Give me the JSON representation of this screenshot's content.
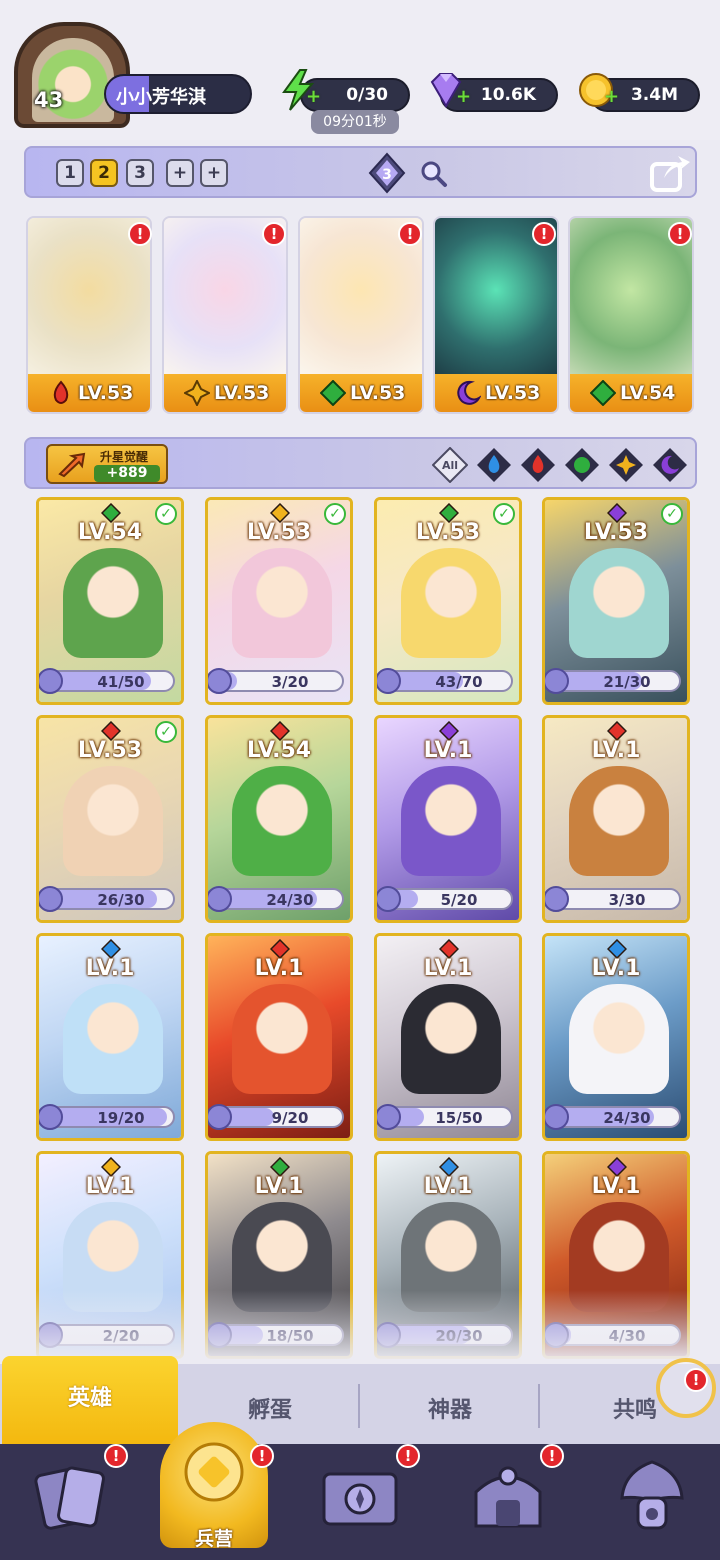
{
  "player": {
    "level": "43",
    "name": "小小芳华淇"
  },
  "resources": {
    "energy": "0/30",
    "energy_timer": "09分01秒",
    "gems": "10.6K",
    "coins": "3.4M",
    "plus": "+"
  },
  "team_tabs": [
    "1",
    "2",
    "3",
    "+",
    "+"
  ],
  "team_active_index": 1,
  "crystal_count": "3",
  "lineup": [
    {
      "level": "LV.53",
      "element": "fire",
      "alert": "!"
    },
    {
      "level": "LV.53",
      "element": "light",
      "alert": "!"
    },
    {
      "level": "LV.53",
      "element": "nature",
      "alert": "!"
    },
    {
      "level": "LV.53",
      "element": "dark",
      "alert": "!"
    },
    {
      "level": "LV.54",
      "element": "nature",
      "alert": "!"
    }
  ],
  "awaken": {
    "label": "升星觉醒",
    "count": "+889"
  },
  "filters": {
    "all": "All",
    "elements": [
      "water",
      "fire",
      "nature",
      "light",
      "dark"
    ]
  },
  "heroes": [
    {
      "level": "LV.54",
      "element": "nature",
      "shards": "41/50",
      "progress": 0.82,
      "checked": true
    },
    {
      "level": "LV.53",
      "element": "light",
      "shards": "3/20",
      "progress": 0.15,
      "checked": true
    },
    {
      "level": "LV.53",
      "element": "nature",
      "shards": "43/70",
      "progress": 0.61,
      "checked": true
    },
    {
      "level": "LV.53",
      "element": "dark",
      "shards": "21/30",
      "progress": 0.7,
      "checked": true
    },
    {
      "level": "LV.53",
      "element": "fire",
      "shards": "26/30",
      "progress": 0.87,
      "checked": true
    },
    {
      "level": "LV.54",
      "element": "fire",
      "shards": "24/30",
      "progress": 0.8,
      "checked": false
    },
    {
      "level": "LV.1",
      "element": "dark",
      "shards": "5/20",
      "progress": 0.25,
      "checked": false
    },
    {
      "level": "LV.1",
      "element": "fire",
      "shards": "3/30",
      "progress": 0.1,
      "checked": false
    },
    {
      "level": "LV.1",
      "element": "water",
      "shards": "19/20",
      "progress": 0.95,
      "checked": false
    },
    {
      "level": "LV.1",
      "element": "fire",
      "shards": "9/20",
      "progress": 0.45,
      "checked": false
    },
    {
      "level": "LV.1",
      "element": "fire",
      "shards": "15/50",
      "progress": 0.3,
      "checked": false
    },
    {
      "level": "LV.1",
      "element": "water",
      "shards": "24/30",
      "progress": 0.8,
      "checked": false
    },
    {
      "level": "LV.1",
      "element": "light",
      "shards": "2/20",
      "progress": 0.1,
      "checked": false
    },
    {
      "level": "LV.1",
      "element": "nature",
      "shards": "18/50",
      "progress": 0.36,
      "checked": false
    },
    {
      "level": "LV.1",
      "element": "water",
      "shards": "20/30",
      "progress": 0.67,
      "checked": false
    },
    {
      "level": "LV.1",
      "element": "dark",
      "shards": "4/30",
      "progress": 0.13,
      "checked": false
    }
  ],
  "sub_tabs": [
    "英雄",
    "孵蛋",
    "神器",
    "共鸣"
  ],
  "bottom_nav": {
    "active_label": "兵营",
    "alert": "!"
  },
  "colors": {
    "fire": "#e2332a",
    "water": "#2f8fe4",
    "nature": "#2fae3e",
    "light": "#f0b21d",
    "dark": "#8a3fd8",
    "accent_gold": "#f5c422",
    "nav_bg": "#363352"
  }
}
